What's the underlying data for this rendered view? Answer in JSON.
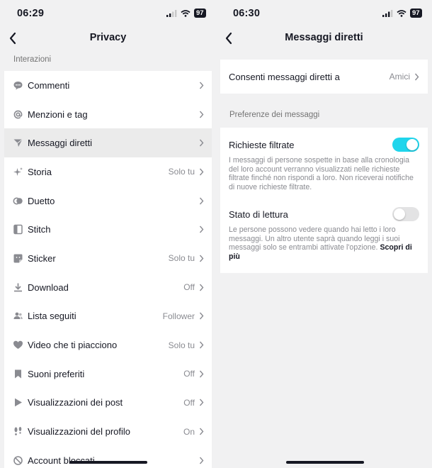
{
  "left": {
    "status": {
      "time": "06:29",
      "battery": "97"
    },
    "title": "Privacy",
    "section_label": "Interazioni",
    "items": [
      {
        "label": "Commenti",
        "value": "",
        "icon": "comment-icon"
      },
      {
        "label": "Menzioni e tag",
        "value": "",
        "icon": "at-icon"
      },
      {
        "label": "Messaggi diretti",
        "value": "",
        "icon": "send-icon"
      },
      {
        "label": "Storia",
        "value": "Solo tu",
        "icon": "sparkle-icon"
      },
      {
        "label": "Duetto",
        "value": "",
        "icon": "duet-icon"
      },
      {
        "label": "Stitch",
        "value": "",
        "icon": "stitch-icon"
      },
      {
        "label": "Sticker",
        "value": "Solo tu",
        "icon": "sticker-icon"
      },
      {
        "label": "Download",
        "value": "Off",
        "icon": "download-icon"
      },
      {
        "label": "Lista seguiti",
        "value": "Follower",
        "icon": "users-icon"
      },
      {
        "label": "Video che ti piacciono",
        "value": "Solo tu",
        "icon": "heart-icon"
      },
      {
        "label": "Suoni preferiti",
        "value": "Off",
        "icon": "bookmark-icon"
      },
      {
        "label": "Visualizzazioni dei post",
        "value": "Off",
        "icon": "play-icon"
      },
      {
        "label": "Visualizzazioni del profilo",
        "value": "On",
        "icon": "footprints-icon"
      },
      {
        "label": "Account bloccati",
        "value": "",
        "icon": "block-icon"
      }
    ]
  },
  "right": {
    "status": {
      "time": "06:30",
      "battery": "97"
    },
    "title": "Messaggi diretti",
    "allow": {
      "label": "Consenti messaggi diretti a",
      "value": "Amici"
    },
    "section_label": "Preferenze dei messaggi",
    "filtered": {
      "title": "Richieste filtrate",
      "desc": "I messaggi di persone sospette in base alla cronologia del loro account verranno visualizzati nelle richieste filtrate finché non rispondi a loro. Non riceverai notifiche di nuove richieste filtrate.",
      "enabled": true
    },
    "read": {
      "title": "Stato di lettura",
      "desc": "Le persone possono vedere quando hai letto i loro messaggi. Un altro utente saprà quando leggi i suoi messaggi solo se entrambi attivate l'opzione.",
      "link": "Scopri di più",
      "enabled": false
    }
  },
  "colors": {
    "accent": "#20d5ec",
    "text": "#161823",
    "secondary": "#8a8b91",
    "background": "#f1f1f2"
  }
}
